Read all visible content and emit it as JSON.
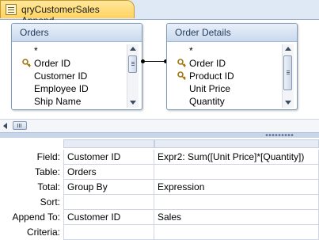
{
  "tab": {
    "label": "qryCustomerSales Append"
  },
  "tables": {
    "orders": {
      "title": "Orders",
      "fields": [
        {
          "label": "*",
          "key": false
        },
        {
          "label": "Order ID",
          "key": true
        },
        {
          "label": "Customer ID",
          "key": false
        },
        {
          "label": "Employee ID",
          "key": false
        },
        {
          "label": "Ship Name",
          "key": false
        }
      ]
    },
    "order_details": {
      "title": "Order Details",
      "fields": [
        {
          "label": "*",
          "key": false
        },
        {
          "label": "Order ID",
          "key": true
        },
        {
          "label": "Product ID",
          "key": true
        },
        {
          "label": "Unit Price",
          "key": false
        },
        {
          "label": "Quantity",
          "key": false
        }
      ]
    }
  },
  "grid": {
    "row_labels": {
      "field": "Field:",
      "table": "Table:",
      "total": "Total:",
      "sort": "Sort:",
      "append_to": "Append To:",
      "criteria": "Criteria:"
    },
    "columns": [
      {
        "field": "Customer ID",
        "table": "Orders",
        "total": "Group By",
        "sort": "",
        "append_to": "Customer ID",
        "criteria": ""
      },
      {
        "field": "Expr2: Sum([Unit Price]*[Quantity])",
        "table": "",
        "total": "Expression",
        "sort": "",
        "append_to": "Sales",
        "criteria": ""
      }
    ]
  },
  "icons": {
    "tab": "query-icon",
    "key": "primary-key-icon"
  }
}
